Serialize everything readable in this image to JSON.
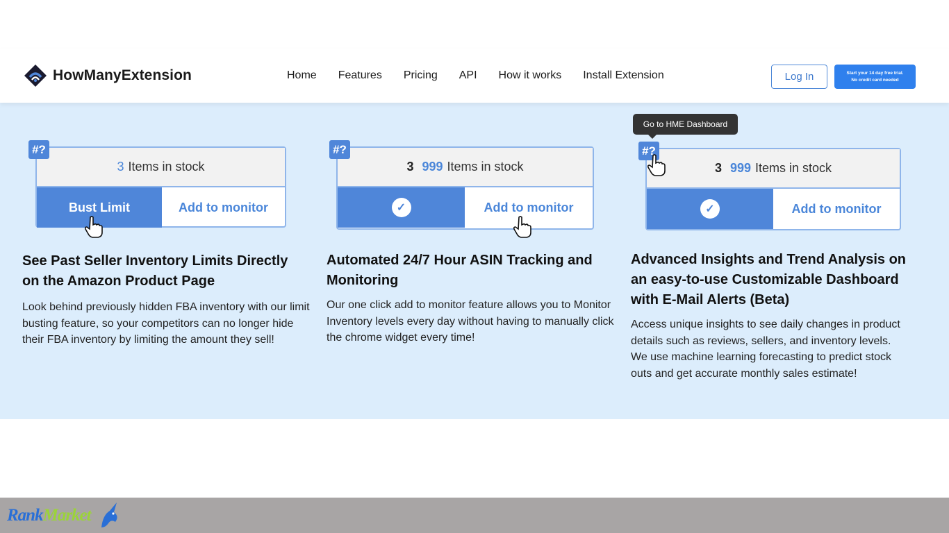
{
  "header": {
    "brand": "HowManyExtension",
    "nav": [
      "Home",
      "Features",
      "Pricing",
      "API",
      "How it works",
      "Install Extension"
    ],
    "login": "Log In",
    "cta_line1": "Start your 14 day free trial.",
    "cta_line2": "No credit card needed"
  },
  "tooltip": "Go to HME Dashboard",
  "widgets": [
    {
      "badge": "#?",
      "num": "3",
      "stock_label": "Items in stock",
      "left": "Bust Limit",
      "right": "Add to monitor"
    },
    {
      "badge": "#?",
      "num1": "3",
      "num2": "999",
      "stock_label": "Items in stock",
      "right": "Add to monitor"
    },
    {
      "badge": "#?",
      "num1": "3",
      "num2": "999",
      "stock_label": "Items in stock",
      "right": "Add to monitor"
    }
  ],
  "cards": [
    {
      "title": "See Past Seller Inventory Limits Directly on the Amazon Product Page",
      "text": "Look behind previously hidden FBA inventory with our limit busting feature, so your competitors can no longer hide their FBA inventory by limiting the amount they sell!"
    },
    {
      "title": "Automated 24/7 Hour ASIN Tracking and Monitoring",
      "text": "Our one click add to monitor feature allows you to Monitor Inventory levels every day without having to manually click the chrome widget every time!"
    },
    {
      "title": "Advanced Insights and Trend Analysis on an easy-to-use Customizable Dashboard with E-Mail Alerts (Beta)",
      "text": "Access unique insights to see daily changes in product details such as reviews, sellers, and inventory levels. We use machine learning forecasting to predict stock outs and get accurate monthly sales estimate!"
    }
  ],
  "footer": {
    "logo_part1": "Rank",
    "logo_part2": "Market"
  }
}
